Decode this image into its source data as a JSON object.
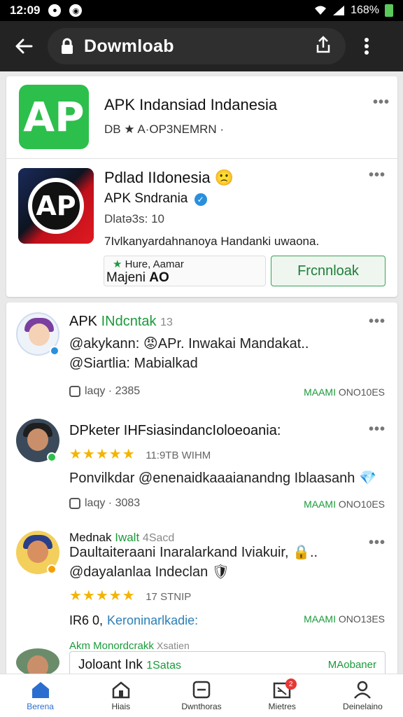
{
  "status_bar": {
    "time": "12:09",
    "battery": "168%",
    "notif1": "●",
    "notif2": "◉"
  },
  "browser": {
    "url_text": "Dowmloab",
    "back_icon": "arrow-left-icon",
    "lock_icon": "lock-icon",
    "share_icon": "share-icon",
    "menu_icon": "more-vert-icon"
  },
  "apps": [
    {
      "title": "APK Indansiad Indanesia",
      "subtitle": "DB ★ A·OP3NEMRN ·",
      "menu": "•••"
    },
    {
      "title": "Pdlad IIdonesia 🙁",
      "developer": "APK Sndrania",
      "downloads": "Dlatə3s: 10",
      "description": "7Ivlkanyardahnanoya Handanki uwaona.",
      "tag_line1_prefix": "Hure,",
      "tag_line1_label": "Aamar",
      "tag_line2_prefix": "Majeni",
      "tag_line2_value": "AO",
      "download_label": "Frcnnloak",
      "menu": "•••"
    }
  ],
  "reviews": [
    {
      "name": "APK",
      "name_highlight": "INdcntak",
      "name_suffix": "13",
      "line1": "@akykann: 😡APr. Inwakai Mandakat..",
      "line2": "@Siartlia: Mabialkad",
      "meta": "laqy · 2385",
      "date_green": "MAAMI",
      "date_gray": "ONO10ES",
      "menu": "•••"
    },
    {
      "name": "DPketer IHFsiasindancIoloeoania:",
      "stars": "★★★★★",
      "star_count": "11:9TB WIHM",
      "line1": "Ponvilkdar @enenaidkaaaianandng Iblaasanh 💎",
      "meta": "laqy · 3083",
      "date_green": "MAAMI",
      "date_gray": "ONO10ES",
      "menu": "•••"
    },
    {
      "name": "Mednak",
      "name_highlight": "Iwalt",
      "name_suffix": "4Sacd",
      "line1": "Daultaiteraani Inaralarkand Iviakuir, 🔒..",
      "line2": "@dayalanlaa Indeclan 🛡",
      "stars": "★★★★★",
      "star_count": "17 STNIP",
      "meta_prefix": "IR6 0,",
      "meta_link": "Keroninarlkadie:",
      "date_green": "MAAMI",
      "date_gray": "ONO13ES",
      "menu": "•••"
    },
    {
      "name": "Akm Monordcrakk",
      "name_suffix": "Xsatien",
      "preview_title": "Joloant Ink",
      "preview_highlight": "1Satas",
      "preview_right": "MAobaner",
      "preview_right_gray": ""
    }
  ],
  "bottom_nav": [
    {
      "label": "Berena",
      "icon": "home-icon",
      "active": true
    },
    {
      "label": "Hiais",
      "icon": "house-outline-icon",
      "active": false
    },
    {
      "label": "Dwnthoras",
      "icon": "minus-box-icon",
      "active": false
    },
    {
      "label": "Mietres",
      "icon": "inbox-icon",
      "active": false,
      "badge": "2"
    },
    {
      "label": "Deinelaino",
      "icon": "person-icon",
      "active": false
    }
  ],
  "colors": {
    "accent_green": "#1a9a3a",
    "toolbar": "#232323",
    "star": "#f4b400",
    "nav_active": "#2a6fcf"
  }
}
